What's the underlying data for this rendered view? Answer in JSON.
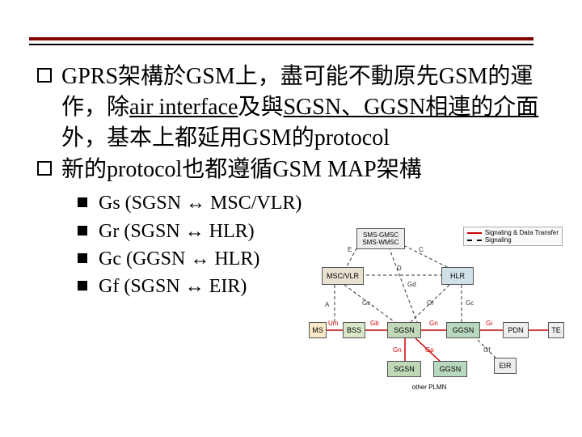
{
  "bullets": {
    "b1_part1": "GPRS架構於GSM上，盡可能不動原先GSM的運作，除",
    "b1_u1": "air interface",
    "b1_mid1": "及與",
    "b1_u2": "SGSN、GGSN相連的介面",
    "b1_part2": "外，基本上都延用GSM的protocol",
    "b2": "新的protocol也都遵循GSM MAP架構"
  },
  "subs": {
    "s1": "Gs (SGSN ↔ MSC/VLR)",
    "s2": "Gr (SGSN ↔ HLR)",
    "s3": "Gc (GGSN ↔ HLR)",
    "s4": "Gf (SGSN ↔ EIR)"
  },
  "diagram": {
    "legend1": "Signaling & Data Transfer",
    "legend2": "Signaling",
    "nodes": {
      "sms1": "SMS-GMSC",
      "sms2": "SMS-WMSC",
      "mscvlr": "MSC/VLR",
      "hlr": "HLR",
      "ms": "MS",
      "bss": "BSS",
      "sgsn": "SGSN",
      "ggsn": "GGSN",
      "pdn": "PDN",
      "te": "TE",
      "sgsn2": "SGSN",
      "ggsn2": "GGSN",
      "eir": "EIR",
      "plmn": "other PLMN"
    },
    "labels": {
      "E": "E",
      "C": "C",
      "D": "D",
      "A": "A",
      "Gd": "Gd",
      "Gs": "Gs",
      "Gr": "Gr",
      "Gc": "Gc",
      "Um": "Um",
      "Gb": "Gb",
      "Gn": "Gn",
      "Gi": "Gi",
      "Gn2": "Gn",
      "Gp": "Gp",
      "Gf": "Gf"
    }
  }
}
